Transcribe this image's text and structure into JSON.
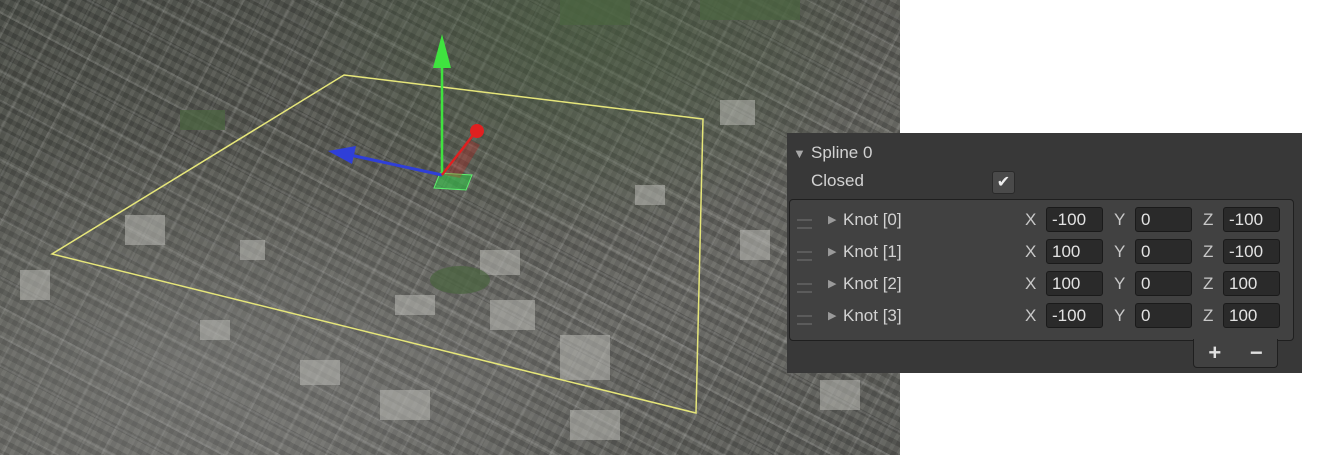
{
  "scene": {
    "description_color": "#e6e67a",
    "gizmo": {
      "y_axis_color": "#3fe33f",
      "z_axis_color": "#2f3fd8",
      "x_axis_color": "#e02020",
      "plane_color": "#33d14a"
    }
  },
  "inspector": {
    "spline_title": "Spline 0",
    "closed_label": "Closed",
    "closed_checked": "✔",
    "knots": [
      {
        "label": "Knot [0]",
        "x": "-100",
        "y": "0",
        "z": "-100"
      },
      {
        "label": "Knot [1]",
        "x": "100",
        "y": "0",
        "z": "-100"
      },
      {
        "label": "Knot [2]",
        "x": "100",
        "y": "0",
        "z": "100"
      },
      {
        "label": "Knot [3]",
        "x": "-100",
        "y": "0",
        "z": "100"
      }
    ],
    "axis_labels": {
      "x": "X",
      "y": "Y",
      "z": "Z"
    },
    "add_label": "+",
    "remove_label": "−"
  }
}
